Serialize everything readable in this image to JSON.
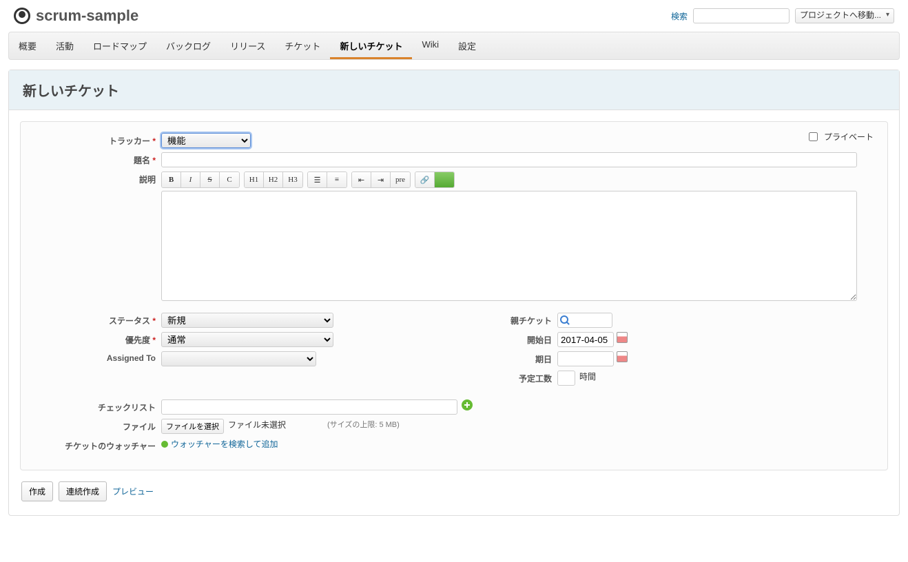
{
  "project_name": "scrum-sample",
  "header": {
    "search_label": "検索",
    "search_value": "",
    "project_jump": "プロジェクトへ移動..."
  },
  "tabs": {
    "overview": "概要",
    "activity": "活動",
    "roadmap": "ロードマップ",
    "backlog": "バックログ",
    "release": "リリース",
    "tickets": "チケット",
    "new_ticket": "新しいチケット",
    "wiki": "Wiki",
    "settings": "設定"
  },
  "page_title": "新しいチケット",
  "form": {
    "tracker_label": "トラッカー",
    "tracker_value": "機能",
    "private_label": "プライベート",
    "subject_label": "題名",
    "subject_value": "",
    "description_label": "説明",
    "description_value": "",
    "status_label": "ステータス",
    "status_value": "新規",
    "priority_label": "優先度",
    "priority_value": "通常",
    "assigned_label": "Assigned To",
    "assigned_value": "",
    "parent_label": "親チケット",
    "parent_value": "",
    "start_date_label": "開始日",
    "start_date_value": "2017-04-05",
    "due_date_label": "期日",
    "due_date_value": "",
    "estimated_label": "予定工数",
    "estimated_value": "",
    "hours_unit": "時間",
    "checklist_label": "チェックリスト",
    "checklist_value": "",
    "file_label": "ファイル",
    "file_button": "ファイルを選択",
    "file_none": "ファイル未選択",
    "file_hint": "(サイズの上限: 5 MB)",
    "watchers_label": "チケットのウォッチャー",
    "watchers_link": "ウォッチャーを検索して追加"
  },
  "toolbar": {
    "b": "B",
    "i": "I",
    "s": "S",
    "c": "C",
    "h1": "H1",
    "h2": "H2",
    "h3": "H3",
    "pre": "pre"
  },
  "actions": {
    "submit": "作成",
    "submit_continue": "連続作成",
    "preview": "プレビュー"
  }
}
